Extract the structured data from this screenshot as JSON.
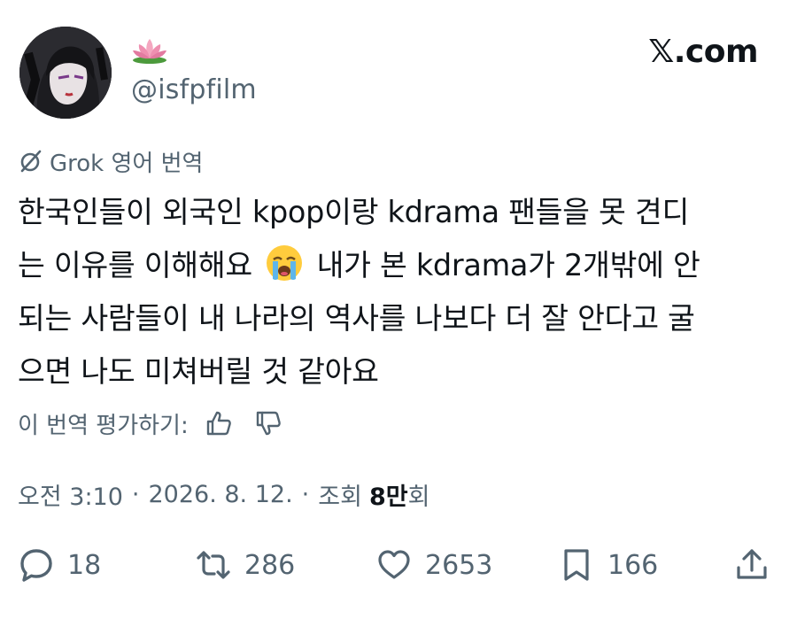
{
  "profile": {
    "handle": "@isfpfilm",
    "display_name_icon": "lotus-emoji",
    "avatar": "anime-style portrait avatar"
  },
  "brand": {
    "label": "𝕏.com"
  },
  "translation": {
    "icon": "grok-icon",
    "label": "Grok 영어 번역"
  },
  "tweet": {
    "lines": [
      "한국인들이 외국인 kpop이랑 kdrama 팬들을 못 견디",
      "는 이유를 이해해요",
      "내가 본 kdrama가 2개밖에 안",
      "되는 사람들이 내 나라의 역사를 나보다 더 잘 안다고 굴",
      "으면 나도 미쳐버릴 것 같아요"
    ],
    "emoji": "loudly-crying-face"
  },
  "rating": {
    "label": "이 번역 평가하기:",
    "thumbs_up_icon": "thumbs-up-icon",
    "thumbs_down_icon": "thumbs-down-icon"
  },
  "meta": {
    "time": "오전 3:10",
    "dot1": "·",
    "date": "2026. 8. 12.",
    "dot2": "·",
    "views_label": "조회",
    "views_count": "8만",
    "views_suffix": "회"
  },
  "actions": {
    "replies": "18",
    "reposts": "286",
    "likes": "2653",
    "bookmarks": "166"
  },
  "colors": {
    "text": "#0f1419",
    "secondary": "#536471",
    "background": "#ffffff"
  }
}
